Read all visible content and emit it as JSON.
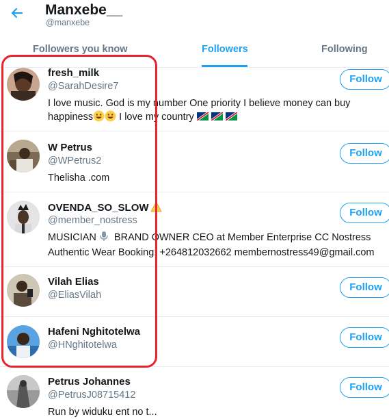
{
  "header": {
    "title": "Manxebe__",
    "handle": "@manxebe"
  },
  "tabs": [
    {
      "label": "Followers you know",
      "active": false
    },
    {
      "label": "Followers",
      "active": true
    },
    {
      "label": "Following",
      "active": false
    }
  ],
  "colors": {
    "accent": "#1da1f2",
    "highlight": "#e8232e",
    "secondary_text": "#657786"
  },
  "follow_label": "Follow",
  "users": [
    {
      "name": "fresh_milk",
      "handle": "@SarahDesire7",
      "bio_line1": "I love music. God is my number One priority I believe money can buy",
      "bio_line2_a": "happiness",
      "bio_line2_b": " I love my country",
      "emoji": [
        "grinning-face",
        "grinning-face"
      ],
      "flags": [
        "namibia-flag",
        "namibia-flag",
        "namibia-flag"
      ]
    },
    {
      "name": "W Petrus",
      "handle": "@WPetrus2",
      "bio_line1": "Thelisha .com"
    },
    {
      "name": "OVENDA_SO_SLOW",
      "handle": "@member_nostress",
      "name_icon": "warning-icon",
      "bio_line1_a": "MUSICIAN",
      "bio_line1_b": " BRAND OWNER CEO at Member Enterprise CC Nostress",
      "bio_line2": "Authentic Wear Booking: +264812032662 membernostress49@gmail.com",
      "bio_icon": "microphone-icon"
    },
    {
      "name": "Vilah Elias",
      "handle": "@EliasVilah"
    },
    {
      "name": "Hafeni Nghitotelwa",
      "handle": "@HNghitotelwa"
    },
    {
      "name": "Petrus Johannes",
      "handle": "@PetrusJ08715412",
      "bio_line1": "Run by widuku ent no t..."
    }
  ]
}
